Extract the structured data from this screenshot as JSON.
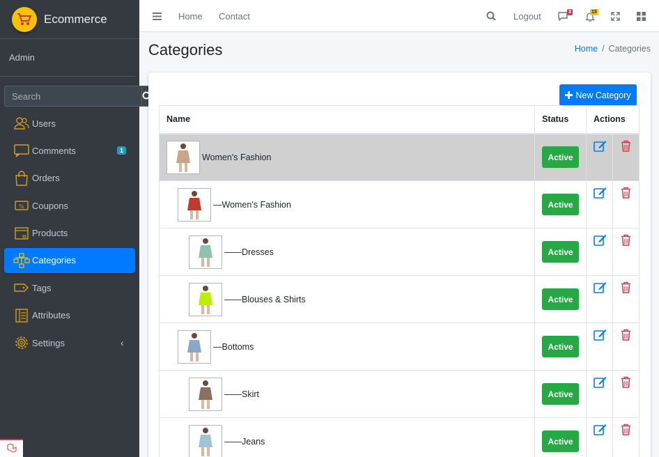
{
  "brand": {
    "name": "Ecommerce"
  },
  "user": {
    "name": "Admin"
  },
  "sidebar_search": {
    "placeholder": "Search"
  },
  "nav": [
    {
      "label": "Users",
      "icon": "users-icon"
    },
    {
      "label": "Comments",
      "icon": "comments-icon",
      "badge": "1"
    },
    {
      "label": "Orders",
      "icon": "shopping-bag-icon"
    },
    {
      "label": "Coupons",
      "icon": "coupon-icon"
    },
    {
      "label": "Products",
      "icon": "box-icon"
    },
    {
      "label": "Categories",
      "icon": "sitemap-icon",
      "active": true
    },
    {
      "label": "Tags",
      "icon": "tag-icon"
    },
    {
      "label": "Attributes",
      "icon": "list-icon"
    },
    {
      "label": "Settings",
      "icon": "gear-icon",
      "expandable": true
    }
  ],
  "topbar": {
    "home": "Home",
    "contact": "Contact",
    "logout": "Logout",
    "messages_count": "3",
    "notifications_count": "15"
  },
  "page": {
    "title": "Categories",
    "breadcrumb_home": "Home",
    "breadcrumb_sep": "/",
    "breadcrumb_current": "Categories"
  },
  "new_button": {
    "label": "New Category"
  },
  "table": {
    "headers": {
      "name": "Name",
      "status": "Status",
      "actions": "Actions"
    },
    "rows": [
      {
        "name": "Women's Fashion",
        "prefix": "",
        "depth": 0,
        "status": "Active",
        "thumb_color": "#c9a58a"
      },
      {
        "name": "Women's Fashion",
        "prefix": "— ",
        "depth": 1,
        "status": "Active",
        "thumb_color": "#c0392b"
      },
      {
        "name": "Dresses",
        "prefix": "—— ",
        "depth": 2,
        "status": "Active",
        "thumb_color": "#8fc1b0"
      },
      {
        "name": "Blouses & Shirts",
        "prefix": "—— ",
        "depth": 2,
        "status": "Active",
        "thumb_color": "#b8f000"
      },
      {
        "name": "Bottoms",
        "prefix": "— ",
        "depth": 1,
        "status": "Active",
        "thumb_color": "#8aa8c8"
      },
      {
        "name": "Skirt",
        "prefix": "—— ",
        "depth": 2,
        "status": "Active",
        "thumb_color": "#8b7060"
      },
      {
        "name": "Jeans",
        "prefix": "—— ",
        "depth": 2,
        "status": "Active",
        "thumb_color": "#9fc4d8"
      }
    ]
  },
  "colors": {
    "primary": "#007bff",
    "success": "#28a745",
    "danger": "#dc3545",
    "sidebar": "#343a40",
    "brand_logo": "#f7c200",
    "highlight_row": "#d0d0d0"
  }
}
